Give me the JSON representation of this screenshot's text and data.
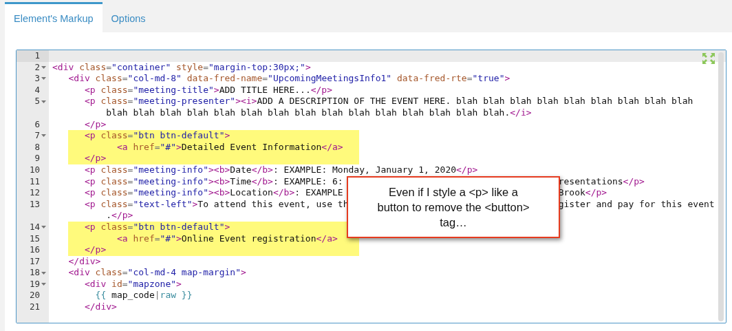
{
  "tabs": [
    {
      "label": "Element's Markup",
      "selected": true
    },
    {
      "label": "Options",
      "selected": false
    }
  ],
  "editor": {
    "lines": [
      {
        "number": "1",
        "fold": false,
        "active": true,
        "highlighted": false
      },
      {
        "number": "2",
        "fold": true,
        "active": false,
        "highlighted": false,
        "tokens": [
          {
            "kind": "tag",
            "text": "<div"
          },
          {
            "kind": "attr",
            "text": " class"
          },
          {
            "kind": "op",
            "text": "="
          },
          {
            "kind": "str",
            "text": "\"container\""
          },
          {
            "kind": "attr",
            "text": " style"
          },
          {
            "kind": "op",
            "text": "="
          },
          {
            "kind": "str",
            "text": "\"margin-top:30px;\""
          },
          {
            "kind": "tag",
            "text": ">"
          }
        ]
      },
      {
        "number": "3",
        "fold": true,
        "active": false,
        "highlighted": false,
        "tokens": [
          {
            "kind": "tag",
            "text": "   <div"
          },
          {
            "kind": "attr",
            "text": " class"
          },
          {
            "kind": "op",
            "text": "="
          },
          {
            "kind": "str",
            "text": "\"col-md-8\""
          },
          {
            "kind": "attr",
            "text": " data-fred-name"
          },
          {
            "kind": "op",
            "text": "="
          },
          {
            "kind": "str",
            "text": "\"UpcomingMeetingsInfo1\""
          },
          {
            "kind": "attr",
            "text": " data-fred-rte"
          },
          {
            "kind": "op",
            "text": "="
          },
          {
            "kind": "str",
            "text": "\"true\""
          },
          {
            "kind": "tag",
            "text": ">"
          }
        ]
      },
      {
        "number": "4",
        "fold": false,
        "active": false,
        "highlighted": false,
        "tokens": [
          {
            "kind": "tag",
            "text": "      <p"
          },
          {
            "kind": "attr",
            "text": " class"
          },
          {
            "kind": "op",
            "text": "="
          },
          {
            "kind": "str",
            "text": "\"meeting-title\""
          },
          {
            "kind": "tag",
            "text": ">"
          },
          {
            "kind": "text",
            "text": "ADD TITLE HERE..."
          },
          {
            "kind": "tag",
            "text": "</p>"
          }
        ]
      },
      {
        "number": "5",
        "fold": true,
        "active": false,
        "highlighted": false,
        "tokens": [
          {
            "kind": "tag",
            "text": "      <p"
          },
          {
            "kind": "attr",
            "text": " class"
          },
          {
            "kind": "op",
            "text": "="
          },
          {
            "kind": "str",
            "text": "\"meeting-presenter\""
          },
          {
            "kind": "tag",
            "text": "><i>"
          },
          {
            "kind": "text",
            "text": "ADD A DESCRIPTION OF THE EVENT HERE. blah blah blah blah blah blah blah blah blah"
          }
        ],
        "continuation": [
          {
            "kind": "text",
            "text": "          blah blah blah blah blah blah blah blah blah blah blah blah blah blah blah."
          },
          {
            "kind": "tag",
            "text": "</i>"
          }
        ]
      },
      {
        "number": "6",
        "fold": false,
        "active": false,
        "highlighted": false,
        "tokens": [
          {
            "kind": "tag",
            "text": "      </p>"
          }
        ]
      },
      {
        "number": "7",
        "fold": true,
        "active": false,
        "highlighted": true,
        "tokens": [
          {
            "kind": "tag",
            "text": "      <p"
          },
          {
            "kind": "attr",
            "text": " class"
          },
          {
            "kind": "op",
            "text": "="
          },
          {
            "kind": "str",
            "text": "\"btn btn-default\""
          },
          {
            "kind": "tag",
            "text": ">"
          }
        ]
      },
      {
        "number": "8",
        "fold": false,
        "active": false,
        "highlighted": true,
        "tokens": [
          {
            "kind": "tag",
            "text": "            <a"
          },
          {
            "kind": "attr",
            "text": " href"
          },
          {
            "kind": "op",
            "text": "="
          },
          {
            "kind": "str",
            "text": "\"#\""
          },
          {
            "kind": "tag",
            "text": ">"
          },
          {
            "kind": "text",
            "text": "Detailed Event Information"
          },
          {
            "kind": "tag",
            "text": "</a>"
          }
        ]
      },
      {
        "number": "9",
        "fold": false,
        "active": false,
        "highlighted": true,
        "tokens": [
          {
            "kind": "tag",
            "text": "      </p>"
          }
        ]
      },
      {
        "number": "10",
        "fold": false,
        "active": false,
        "highlighted": false,
        "tokens": [
          {
            "kind": "tag",
            "text": "      <p"
          },
          {
            "kind": "attr",
            "text": " class"
          },
          {
            "kind": "op",
            "text": "="
          },
          {
            "kind": "str",
            "text": "\"meeting-info\""
          },
          {
            "kind": "tag",
            "text": "><b>"
          },
          {
            "kind": "text",
            "text": "Date"
          },
          {
            "kind": "tag",
            "text": "</b>"
          },
          {
            "kind": "text",
            "text": ": EXAMPLE: Monday, January 1, 2020"
          },
          {
            "kind": "tag",
            "text": "</p>"
          }
        ]
      },
      {
        "number": "11",
        "fold": false,
        "active": false,
        "highlighted": false,
        "tokens": [
          {
            "kind": "tag",
            "text": "      <p"
          },
          {
            "kind": "attr",
            "text": " class"
          },
          {
            "kind": "op",
            "text": "="
          },
          {
            "kind": "str",
            "text": "\"meeting-info\""
          },
          {
            "kind": "tag",
            "text": "><b>"
          },
          {
            "kind": "text",
            "text": "Time"
          },
          {
            "kind": "tag",
            "text": "</b>"
          },
          {
            "kind": "text",
            "text": ": EXAMPLE: 6:"
          }
        ],
        "tokens_right": [
          {
            "kind": "text",
            "text": "resentations"
          },
          {
            "kind": "tag",
            "text": "</p>"
          }
        ]
      },
      {
        "number": "12",
        "fold": false,
        "active": false,
        "highlighted": false,
        "tokens": [
          {
            "kind": "tag",
            "text": "      <p"
          },
          {
            "kind": "attr",
            "text": " class"
          },
          {
            "kind": "op",
            "text": "="
          },
          {
            "kind": "str",
            "text": "\"meeting-info\""
          },
          {
            "kind": "tag",
            "text": "><b>"
          },
          {
            "kind": "text",
            "text": "Location"
          },
          {
            "kind": "tag",
            "text": "</b>"
          },
          {
            "kind": "text",
            "text": ": EXAMPLE"
          }
        ],
        "tokens_right": [
          {
            "kind": "text",
            "text": "Brook"
          },
          {
            "kind": "tag",
            "text": "</p>"
          }
        ]
      },
      {
        "number": "13",
        "fold": false,
        "active": false,
        "highlighted": false,
        "tokens": [
          {
            "kind": "tag",
            "text": "      <p"
          },
          {
            "kind": "attr",
            "text": " class"
          },
          {
            "kind": "op",
            "text": "="
          },
          {
            "kind": "str",
            "text": "\"text-left\""
          },
          {
            "kind": "tag",
            "text": ">"
          },
          {
            "kind": "text",
            "text": "To attend this event, use th"
          }
        ],
        "tokens_right": [
          {
            "kind": "text",
            "text": "gister and pay for this event"
          }
        ],
        "continuation": [
          {
            "kind": "text",
            "text": "          ."
          },
          {
            "kind": "tag",
            "text": "</p>"
          }
        ]
      },
      {
        "number": "14",
        "fold": true,
        "active": false,
        "highlighted": true,
        "tokens": [
          {
            "kind": "tag",
            "text": "      <p"
          },
          {
            "kind": "attr",
            "text": " class"
          },
          {
            "kind": "op",
            "text": "="
          },
          {
            "kind": "str",
            "text": "\"btn btn-default\""
          },
          {
            "kind": "tag",
            "text": ">"
          }
        ]
      },
      {
        "number": "15",
        "fold": false,
        "active": false,
        "highlighted": true,
        "tokens": [
          {
            "kind": "tag",
            "text": "            <a"
          },
          {
            "kind": "attr",
            "text": " href"
          },
          {
            "kind": "op",
            "text": "="
          },
          {
            "kind": "str",
            "text": "\"#\""
          },
          {
            "kind": "tag",
            "text": ">"
          },
          {
            "kind": "text",
            "text": "Online Event registration"
          },
          {
            "kind": "tag",
            "text": "</a>"
          }
        ]
      },
      {
        "number": "16",
        "fold": false,
        "active": false,
        "highlighted": true,
        "tokens": [
          {
            "kind": "tag",
            "text": "      </p>"
          }
        ]
      },
      {
        "number": "17",
        "fold": false,
        "active": false,
        "highlighted": false,
        "tokens": [
          {
            "kind": "tag",
            "text": "   </div>"
          }
        ]
      },
      {
        "number": "18",
        "fold": true,
        "active": false,
        "highlighted": false,
        "tokens": [
          {
            "kind": "tag",
            "text": "   <div"
          },
          {
            "kind": "attr",
            "text": " class"
          },
          {
            "kind": "op",
            "text": "="
          },
          {
            "kind": "str",
            "text": "\"col-md-4 map-margin\""
          },
          {
            "kind": "tag",
            "text": ">"
          }
        ]
      },
      {
        "number": "19",
        "fold": true,
        "active": false,
        "highlighted": false,
        "tokens": [
          {
            "kind": "tag",
            "text": "      <div"
          },
          {
            "kind": "attr",
            "text": " id"
          },
          {
            "kind": "op",
            "text": "="
          },
          {
            "kind": "str",
            "text": "\"mapzone\""
          },
          {
            "kind": "tag",
            "text": ">"
          }
        ]
      },
      {
        "number": "20",
        "fold": false,
        "active": false,
        "highlighted": false,
        "tokens": [
          {
            "kind": "tpl",
            "text": "        {{"
          },
          {
            "kind": "text",
            "text": " map_code"
          },
          {
            "kind": "op",
            "text": "|"
          },
          {
            "kind": "tpl",
            "text": "raw }}"
          }
        ]
      },
      {
        "number": "21",
        "fold": false,
        "active": false,
        "highlighted": false,
        "tokens": [
          {
            "kind": "tag",
            "text": "      </div>"
          }
        ]
      }
    ]
  },
  "callout": {
    "text": "Even if I style a <p> like a button to remove the <button> tag…"
  }
}
